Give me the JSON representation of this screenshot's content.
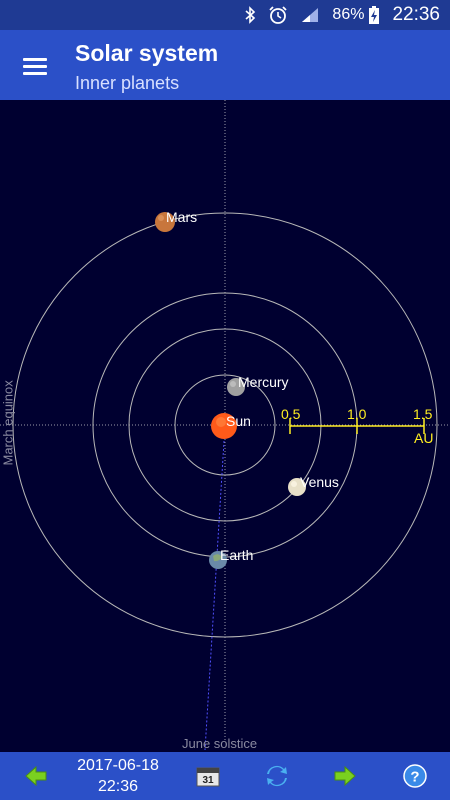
{
  "status_bar": {
    "battery": "86%",
    "time": "22:36",
    "icons": [
      "bluetooth-icon",
      "alarm-icon",
      "signal-icon",
      "battery-charging-icon"
    ]
  },
  "app_bar": {
    "title": "Solar system",
    "subtitle": "Inner planets",
    "menu_icon": "hamburger-menu-icon"
  },
  "plot": {
    "bodies": [
      {
        "name": "Sun",
        "color": "#ff5a1a"
      },
      {
        "name": "Mercury",
        "color": "#a0a0a0"
      },
      {
        "name": "Venus",
        "color": "#e8e0c8"
      },
      {
        "name": "Earth",
        "color": "#6a8aa8"
      },
      {
        "name": "Mars",
        "color": "#c8763c"
      }
    ],
    "scale": {
      "ticks": [
        "0.5",
        "1.0",
        "1.5"
      ],
      "unit": "AU",
      "color": "#ffee22"
    },
    "axis_labels": {
      "left": "March equinox",
      "bottom": "June solstice"
    },
    "orbit_color": "#b8b8b8",
    "axis_color": "#9a9aa8"
  },
  "bottom_bar": {
    "date": "2017-06-18",
    "time": "22:36",
    "calendar_day": "31",
    "buttons": [
      "arrow-left-icon",
      "calendar-icon",
      "refresh-icon",
      "arrow-right-icon",
      "help-icon"
    ]
  }
}
